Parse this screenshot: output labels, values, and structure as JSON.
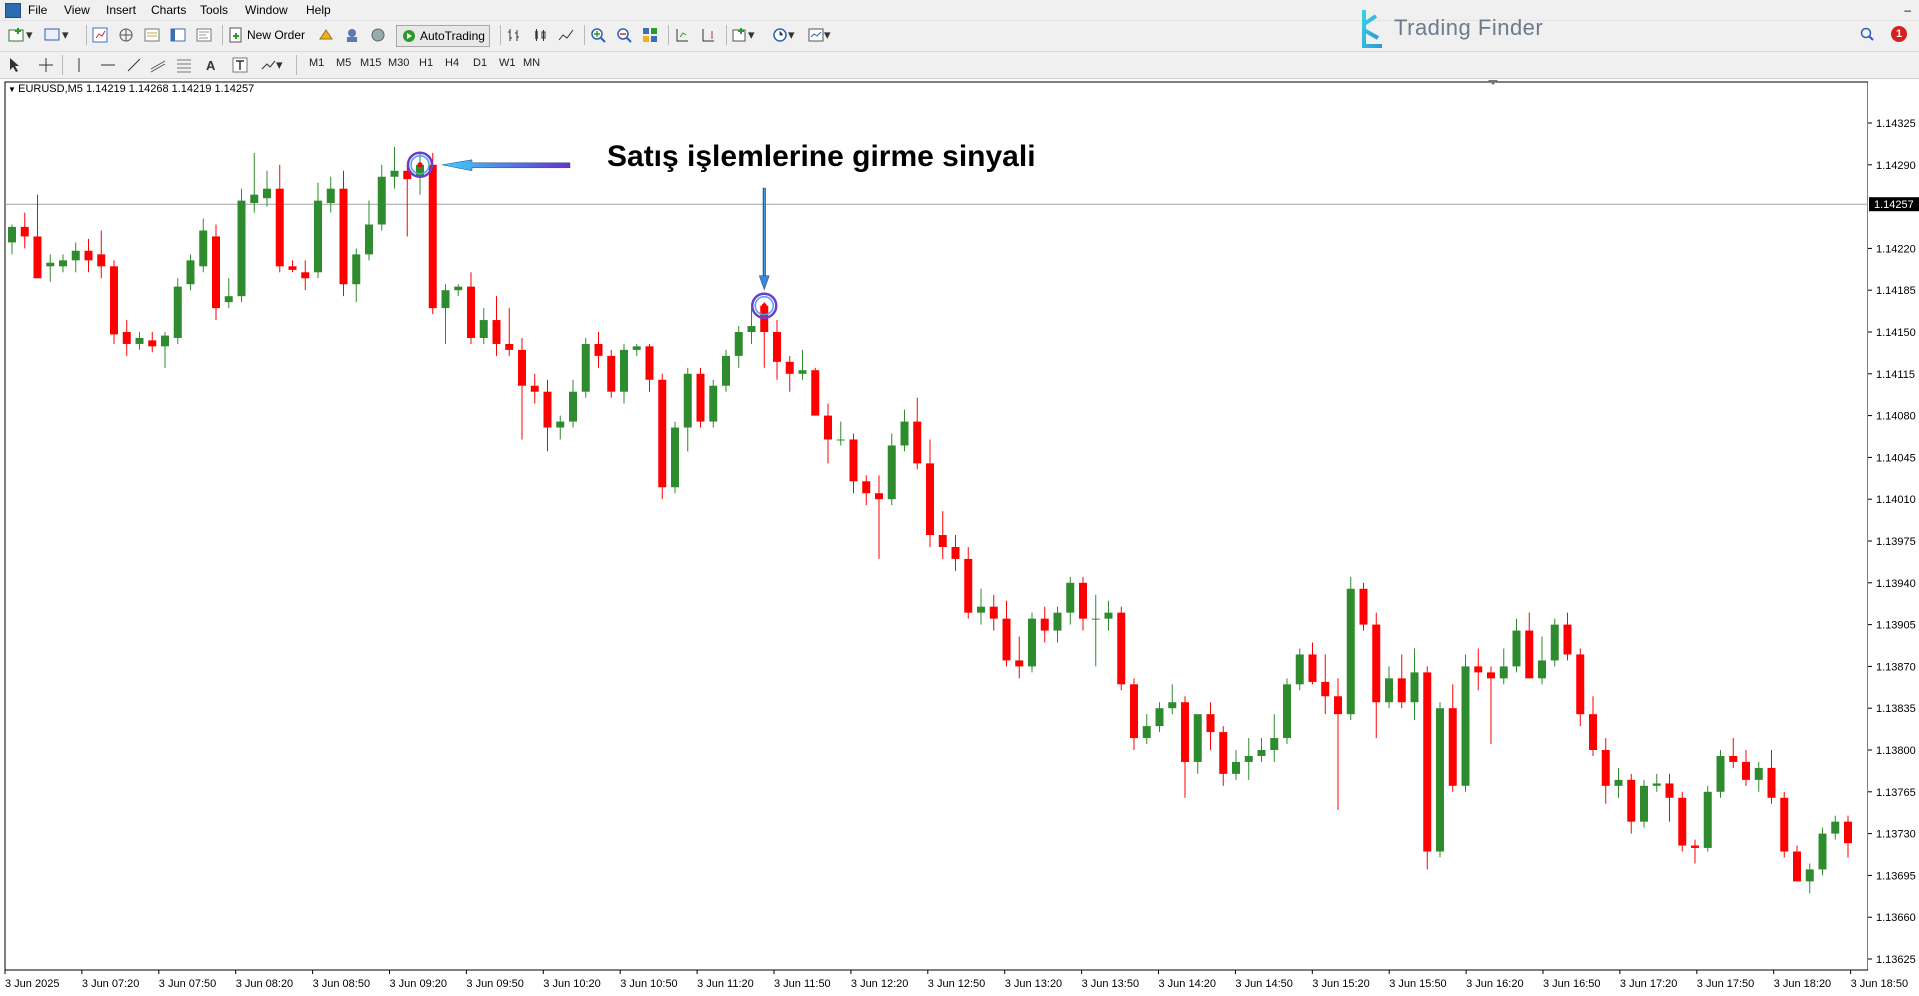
{
  "menu": [
    "File",
    "View",
    "Insert",
    "Charts",
    "Tools",
    "Window",
    "Help"
  ],
  "toolbar": {
    "new_order_label": "New Order",
    "autotrading_label": "AutoTrading",
    "timeframes": [
      "M1",
      "M5",
      "M15",
      "M30",
      "H1",
      "H4",
      "D1",
      "W1",
      "MN"
    ]
  },
  "brand": {
    "name": "Trading Finder"
  },
  "notification_count": "1",
  "chart_header": {
    "symbol_info": "EURUSD,M5  1.14219 1.14268 1.14219 1.14257"
  },
  "annotation": {
    "text": "Satış işlemlerine girme sinyali"
  },
  "colors": {
    "bull": "#2e8b2e",
    "bear": "#ff0000",
    "signal_ring": "#6a3fd0",
    "arrow": "#3bb8ff"
  },
  "chart_data": {
    "type": "candlestick",
    "price_axis_labels": [
      "1.14325",
      "1.14290",
      "1.14257",
      "1.14220",
      "1.14185",
      "1.14150",
      "1.14115",
      "1.14080",
      "1.14045",
      "1.14010",
      "1.13975",
      "1.13940",
      "1.13905",
      "1.13870",
      "1.13835",
      "1.13800",
      "1.13765",
      "1.13730",
      "1.13695",
      "1.13660",
      "1.13625"
    ],
    "current_price": "1.14257",
    "time_axis_labels": [
      "3 Jun 2025",
      "3 Jun 07:20",
      "3 Jun 07:50",
      "3 Jun 08:20",
      "3 Jun 08:50",
      "3 Jun 09:20",
      "3 Jun 09:50",
      "3 Jun 10:20",
      "3 Jun 10:50",
      "3 Jun 11:20",
      "3 Jun 11:50",
      "3 Jun 12:20",
      "3 Jun 12:50",
      "3 Jun 13:20",
      "3 Jun 13:50",
      "3 Jun 14:20",
      "3 Jun 14:50",
      "3 Jun 15:20",
      "3 Jun 15:50",
      "3 Jun 16:20",
      "3 Jun 16:50",
      "3 Jun 17:20",
      "3 Jun 17:50",
      "3 Jun 18:20",
      "3 Jun 18:50"
    ],
    "ohlc": [
      [
        1.14225,
        1.1424,
        1.14215,
        1.14238
      ],
      [
        1.14238,
        1.1425,
        1.1422,
        1.1423
      ],
      [
        1.1423,
        1.14265,
        1.14195,
        1.14195
      ],
      [
        1.14205,
        1.14215,
        1.14192,
        1.14208
      ],
      [
        1.14205,
        1.14215,
        1.142,
        1.1421
      ],
      [
        1.1421,
        1.14225,
        1.142,
        1.14218
      ],
      [
        1.14218,
        1.14228,
        1.142,
        1.1421
      ],
      [
        1.14215,
        1.14235,
        1.14195,
        1.14205
      ],
      [
        1.14205,
        1.1421,
        1.1414,
        1.14148
      ],
      [
        1.1415,
        1.1416,
        1.1413,
        1.1414
      ],
      [
        1.1414,
        1.1415,
        1.14135,
        1.14145
      ],
      [
        1.14143,
        1.1415,
        1.14133,
        1.14138
      ],
      [
        1.14138,
        1.1415,
        1.1412,
        1.14147
      ],
      [
        1.14145,
        1.14195,
        1.1414,
        1.14188
      ],
      [
        1.1419,
        1.14215,
        1.14185,
        1.1421
      ],
      [
        1.14205,
        1.14245,
        1.142,
        1.14235
      ],
      [
        1.1423,
        1.1424,
        1.1416,
        1.1417
      ],
      [
        1.14175,
        1.14195,
        1.1417,
        1.1418
      ],
      [
        1.1418,
        1.1427,
        1.14175,
        1.1426
      ],
      [
        1.14258,
        1.143,
        1.1425,
        1.14265
      ],
      [
        1.14262,
        1.14285,
        1.14255,
        1.1427
      ],
      [
        1.1427,
        1.1429,
        1.142,
        1.14205
      ],
      [
        1.14205,
        1.1421,
        1.142,
        1.14202
      ],
      [
        1.142,
        1.1421,
        1.14185,
        1.14195
      ],
      [
        1.142,
        1.14275,
        1.14195,
        1.1426
      ],
      [
        1.14258,
        1.1428,
        1.1425,
        1.1427
      ],
      [
        1.1427,
        1.14285,
        1.1418,
        1.1419
      ],
      [
        1.1419,
        1.1422,
        1.14175,
        1.14215
      ],
      [
        1.14215,
        1.1426,
        1.1421,
        1.1424
      ],
      [
        1.1424,
        1.1429,
        1.14235,
        1.1428
      ],
      [
        1.1428,
        1.14305,
        1.1427,
        1.14285
      ],
      [
        1.14285,
        1.1429,
        1.1423,
        1.14278
      ],
      [
        1.1428,
        1.143,
        1.14265,
        1.1429
      ],
      [
        1.1429,
        1.143,
        1.14165,
        1.1417
      ],
      [
        1.1417,
        1.1419,
        1.1414,
        1.14185
      ],
      [
        1.14185,
        1.1419,
        1.1418,
        1.14188
      ],
      [
        1.14188,
        1.142,
        1.1414,
        1.14145
      ],
      [
        1.14145,
        1.1417,
        1.1414,
        1.1416
      ],
      [
        1.1416,
        1.1418,
        1.1413,
        1.1414
      ],
      [
        1.1414,
        1.1417,
        1.1413,
        1.14135
      ],
      [
        1.14135,
        1.14145,
        1.1406,
        1.14105
      ],
      [
        1.14105,
        1.14115,
        1.1409,
        1.141
      ],
      [
        1.141,
        1.1411,
        1.1405,
        1.1407
      ],
      [
        1.1407,
        1.1408,
        1.1406,
        1.14075
      ],
      [
        1.14075,
        1.1411,
        1.1407,
        1.141
      ],
      [
        1.141,
        1.14145,
        1.14095,
        1.1414
      ],
      [
        1.1414,
        1.1415,
        1.1412,
        1.1413
      ],
      [
        1.1413,
        1.14135,
        1.14095,
        1.141
      ],
      [
        1.141,
        1.1414,
        1.1409,
        1.14135
      ],
      [
        1.14135,
        1.1414,
        1.1413,
        1.14138
      ],
      [
        1.14138,
        1.1414,
        1.141,
        1.1411
      ],
      [
        1.1411,
        1.14115,
        1.1401,
        1.1402
      ],
      [
        1.1402,
        1.14075,
        1.14015,
        1.1407
      ],
      [
        1.1407,
        1.1412,
        1.1405,
        1.14115
      ],
      [
        1.14115,
        1.1412,
        1.1407,
        1.14075
      ],
      [
        1.14075,
        1.1411,
        1.1407,
        1.14105
      ],
      [
        1.14105,
        1.14135,
        1.141,
        1.1413
      ],
      [
        1.1413,
        1.14155,
        1.1412,
        1.1415
      ],
      [
        1.1415,
        1.1417,
        1.1414,
        1.14155
      ],
      [
        1.14172,
        1.14175,
        1.1412,
        1.1415
      ],
      [
        1.1415,
        1.1416,
        1.1411,
        1.14125
      ],
      [
        1.14125,
        1.1413,
        1.141,
        1.14115
      ],
      [
        1.14115,
        1.14135,
        1.1411,
        1.14118
      ],
      [
        1.14118,
        1.1412,
        1.1408,
        1.1408
      ],
      [
        1.1408,
        1.1409,
        1.1404,
        1.1406
      ],
      [
        1.1406,
        1.14075,
        1.14055,
        1.1406
      ],
      [
        1.1406,
        1.14065,
        1.14015,
        1.14025
      ],
      [
        1.14025,
        1.1403,
        1.14005,
        1.14015
      ],
      [
        1.14015,
        1.1403,
        1.1396,
        1.1401
      ],
      [
        1.1401,
        1.14065,
        1.14005,
        1.14055
      ],
      [
        1.14055,
        1.14085,
        1.1405,
        1.14075
      ],
      [
        1.14075,
        1.14095,
        1.14035,
        1.1404
      ],
      [
        1.1404,
        1.1406,
        1.1397,
        1.1398
      ],
      [
        1.1398,
        1.14,
        1.1396,
        1.1397
      ],
      [
        1.1397,
        1.1398,
        1.1395,
        1.1396
      ],
      [
        1.1396,
        1.1397,
        1.1391,
        1.13915
      ],
      [
        1.13915,
        1.13935,
        1.13905,
        1.1392
      ],
      [
        1.1392,
        1.1393,
        1.139,
        1.1391
      ],
      [
        1.1391,
        1.13925,
        1.1387,
        1.13875
      ],
      [
        1.13875,
        1.13895,
        1.1386,
        1.1387
      ],
      [
        1.1387,
        1.13915,
        1.13865,
        1.1391
      ],
      [
        1.1391,
        1.1392,
        1.1389,
        1.139
      ],
      [
        1.139,
        1.1392,
        1.1389,
        1.13915
      ],
      [
        1.13915,
        1.13945,
        1.13905,
        1.1394
      ],
      [
        1.1394,
        1.13945,
        1.139,
        1.1391
      ],
      [
        1.1391,
        1.1393,
        1.1387,
        1.1391
      ],
      [
        1.1391,
        1.13925,
        1.139,
        1.13915
      ],
      [
        1.13915,
        1.1392,
        1.1385,
        1.13855
      ],
      [
        1.13855,
        1.1386,
        1.138,
        1.1381
      ],
      [
        1.1381,
        1.1383,
        1.13805,
        1.1382
      ],
      [
        1.1382,
        1.1384,
        1.13815,
        1.13835
      ],
      [
        1.13835,
        1.13855,
        1.1383,
        1.1384
      ],
      [
        1.1384,
        1.13845,
        1.1376,
        1.1379
      ],
      [
        1.1379,
        1.1382,
        1.1378,
        1.1383
      ],
      [
        1.1383,
        1.1384,
        1.138,
        1.13815
      ],
      [
        1.13815,
        1.1382,
        1.1377,
        1.1378
      ],
      [
        1.1378,
        1.138,
        1.13775,
        1.1379
      ],
      [
        1.1379,
        1.1381,
        1.13775,
        1.13795
      ],
      [
        1.13795,
        1.1381,
        1.1379,
        1.138
      ],
      [
        1.138,
        1.1383,
        1.1379,
        1.1381
      ],
      [
        1.1381,
        1.1386,
        1.13805,
        1.13855
      ],
      [
        1.13855,
        1.13885,
        1.1385,
        1.1388
      ],
      [
        1.1388,
        1.1389,
        1.13855,
        1.13857
      ],
      [
        1.13857,
        1.1388,
        1.1383,
        1.13845
      ],
      [
        1.13845,
        1.1386,
        1.1375,
        1.1383
      ],
      [
        1.1383,
        1.13945,
        1.13825,
        1.13935
      ],
      [
        1.13935,
        1.1394,
        1.139,
        1.13905
      ],
      [
        1.13905,
        1.13915,
        1.1381,
        1.1384
      ],
      [
        1.1384,
        1.1387,
        1.13835,
        1.1386
      ],
      [
        1.1386,
        1.1388,
        1.13835,
        1.1384
      ],
      [
        1.1384,
        1.13885,
        1.13825,
        1.13865
      ],
      [
        1.13865,
        1.1387,
        1.137,
        1.13715
      ],
      [
        1.13715,
        1.1384,
        1.1371,
        1.13835
      ],
      [
        1.13835,
        1.13855,
        1.13765,
        1.1377
      ],
      [
        1.1377,
        1.1388,
        1.13765,
        1.1387
      ],
      [
        1.1387,
        1.13885,
        1.1385,
        1.13865
      ],
      [
        1.13865,
        1.1387,
        1.13805,
        1.1386
      ],
      [
        1.1386,
        1.13885,
        1.13855,
        1.1387
      ],
      [
        1.1387,
        1.1391,
        1.13865,
        1.139
      ],
      [
        1.139,
        1.13915,
        1.1386,
        1.1386
      ],
      [
        1.1386,
        1.13895,
        1.13855,
        1.13875
      ],
      [
        1.13875,
        1.1391,
        1.1387,
        1.13905
      ],
      [
        1.13905,
        1.13915,
        1.13875,
        1.1388
      ],
      [
        1.1388,
        1.13885,
        1.1382,
        1.1383
      ],
      [
        1.1383,
        1.13845,
        1.13795,
        1.138
      ],
      [
        1.138,
        1.1381,
        1.13755,
        1.1377
      ],
      [
        1.1377,
        1.13785,
        1.1376,
        1.13775
      ],
      [
        1.13775,
        1.1378,
        1.1373,
        1.1374
      ],
      [
        1.1374,
        1.13775,
        1.13735,
        1.1377
      ],
      [
        1.1377,
        1.1378,
        1.13765,
        1.13772
      ],
      [
        1.13772,
        1.1378,
        1.1374,
        1.1376
      ],
      [
        1.1376,
        1.13765,
        1.13715,
        1.1372
      ],
      [
        1.1372,
        1.13725,
        1.13705,
        1.13718
      ],
      [
        1.13718,
        1.1377,
        1.13715,
        1.13765
      ],
      [
        1.13765,
        1.138,
        1.1376,
        1.13795
      ],
      [
        1.13795,
        1.1381,
        1.13785,
        1.1379
      ],
      [
        1.1379,
        1.138,
        1.1377,
        1.13775
      ],
      [
        1.13775,
        1.1379,
        1.13765,
        1.13785
      ],
      [
        1.13785,
        1.138,
        1.13755,
        1.1376
      ],
      [
        1.1376,
        1.13765,
        1.1371,
        1.13715
      ],
      [
        1.13715,
        1.1372,
        1.1369,
        1.1369
      ],
      [
        1.1369,
        1.13705,
        1.1368,
        1.137
      ],
      [
        1.137,
        1.13735,
        1.13695,
        1.1373
      ],
      [
        1.1373,
        1.13745,
        1.13725,
        1.1374
      ],
      [
        1.1374,
        1.13745,
        1.1371,
        1.13722
      ]
    ],
    "signals": [
      {
        "candle": 32,
        "price": 1.1429
      },
      {
        "candle": 59,
        "price": 1.14172
      }
    ]
  }
}
